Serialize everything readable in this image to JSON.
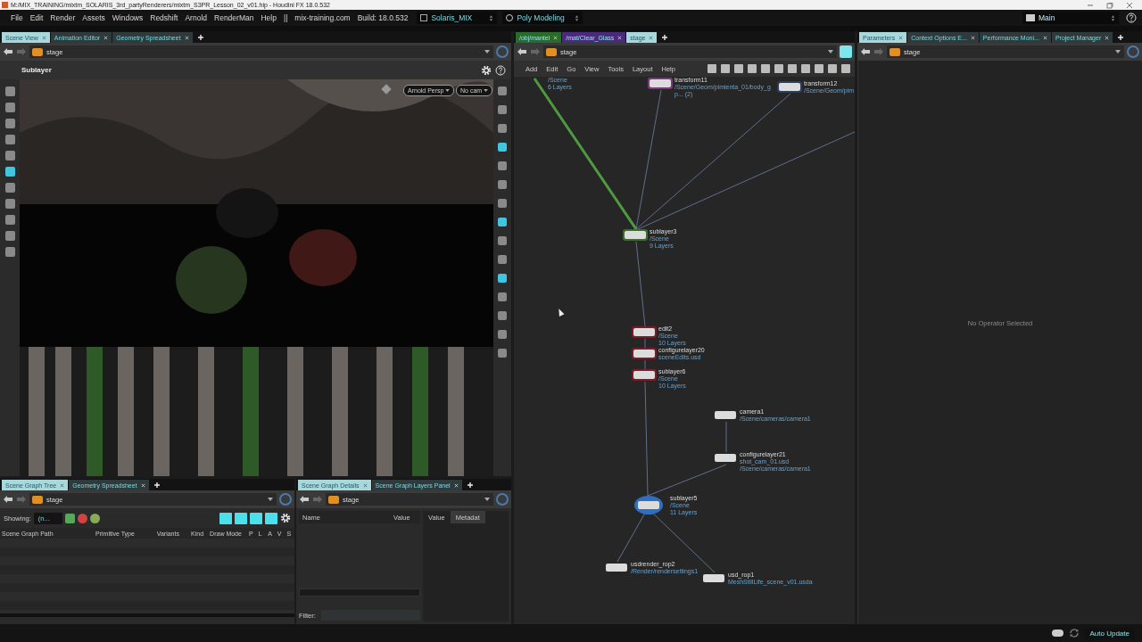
{
  "window": {
    "title": "M:/MIX_TRAINING/mixtm_SOLARIS_3rd_partyRenderers/mixtm_S3PR_Lesson_02_v01.hip - Houdini FX 18.0.532"
  },
  "menu": [
    "File",
    "Edit",
    "Render",
    "Assets",
    "Windows",
    "Redshift",
    "Arnold",
    "RenderMan",
    "Help"
  ],
  "menu_extra": [
    "||",
    "mix-training.com",
    "Build: 18.0.532"
  ],
  "desktops": [
    {
      "label": "Solaris_MIX",
      "kind": "layout"
    },
    {
      "label": "Poly Modeling",
      "kind": "target"
    }
  ],
  "desktop_right": "Main",
  "viewer": {
    "tabs": [
      {
        "label": "Scene View",
        "selected": true
      },
      {
        "label": "Animation Editor",
        "selected": false
      },
      {
        "label": "Geometry Spreadsheet",
        "selected": false
      }
    ],
    "path": "stage",
    "tool": "Sublayer",
    "camera_menus": [
      "Arnold  Persp",
      "No cam"
    ]
  },
  "network": {
    "tabs": [
      {
        "label": "/obj/mantel",
        "selected": false,
        "color": "#2a6a2a"
      },
      {
        "label": "/mat/Clear_Glass",
        "selected": false,
        "color": "#4a2a7a"
      },
      {
        "label": "stage",
        "selected": true
      }
    ],
    "path": "stage",
    "menu": [
      "Add",
      "Edit",
      "Go",
      "View",
      "Tools",
      "Layout",
      "Help"
    ],
    "nodes": [
      {
        "info": [
          "/Scene",
          "6 Layers"
        ]
      },
      {
        "name": "transform11",
        "info": [
          "/Scene/Geom/pimienta_01/body_g",
          "p... (2)"
        ],
        "color": "#7a3a7a"
      },
      {
        "name": "transform12",
        "info": [
          "/Scene/Geom/pim"
        ],
        "color": "#2a3e5e"
      },
      {
        "name": "sublayer3",
        "info": [
          "/Scene",
          "9 Layers"
        ],
        "color": "#3a6e2a"
      },
      {
        "name": "edit2",
        "info": [
          "/Scene",
          "10 Layers"
        ],
        "color": "#7a1a2a"
      },
      {
        "name": "configurelayer20",
        "info": [
          "sceneEdits.usd"
        ],
        "color": "#7a1a2a"
      },
      {
        "name": "sublayer6",
        "info": [
          "/Scene",
          "10 Layers"
        ],
        "color": "#7a1a2a"
      },
      {
        "name": "camera1",
        "info": [
          "/Scene/cameras/camera1"
        ]
      },
      {
        "name": "configurelayer21",
        "info": [
          "shot_cam_01.usd",
          "/Scene/cameras/camera1"
        ]
      },
      {
        "name": "sublayer5",
        "info": [
          "/Scene",
          "11 Layers"
        ],
        "color": "#2f6fbf"
      },
      {
        "name": "usdrender_rop2",
        "info": [
          "/Render/rendersettings1"
        ]
      },
      {
        "name": "usd_rop1",
        "info": [
          "MeshStillLife_scene_v01.usda"
        ]
      }
    ]
  },
  "parameters": {
    "tabs": [
      {
        "label": "Parameters",
        "selected": true
      },
      {
        "label": "Context Options E...",
        "selected": false
      },
      {
        "label": "Performance Moni...",
        "selected": false
      },
      {
        "label": "Project Manager",
        "selected": false
      }
    ],
    "path": "stage",
    "message": "No Operator Selected"
  },
  "scene_graph": {
    "tabs": [
      {
        "label": "Scene Graph Tree",
        "selected": true
      },
      {
        "label": "Geometry Spreadsheet",
        "selected": false
      }
    ],
    "path": "stage",
    "showing_label": "Showing:",
    "showing": "(n...",
    "columns": [
      "Scene Graph Path",
      "Primitive Type",
      "Variants",
      "Kind",
      "Draw Mode",
      "P",
      "L",
      "A",
      "V",
      "S"
    ]
  },
  "details": {
    "tabs": [
      {
        "label": "Scene Graph Details",
        "selected": true
      },
      {
        "label": "Scene Graph Layers Panel",
        "selected": false
      }
    ],
    "path": "stage",
    "columns": [
      "Name",
      "Value"
    ],
    "value_tabs": [
      {
        "label": "Value",
        "selected": true
      },
      {
        "label": "Metadat",
        "selected": false
      }
    ],
    "filter_label": "Filter:"
  },
  "status_bar": {
    "update_mode": "Auto Update"
  }
}
